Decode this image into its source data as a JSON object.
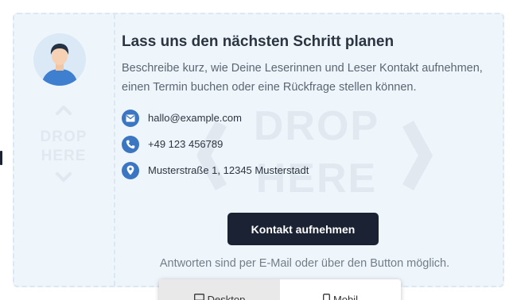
{
  "card": {
    "headline": "Lass uns den nächsten Schritt planen",
    "lead": "Beschreibe kurz, wie Deine Leserinnen und Leser Kontakt aufnehmen, einen Termin buchen oder eine Rückfrage stellen können.",
    "contacts": [
      {
        "icon": "mail-icon",
        "text": "hallo@example.com"
      },
      {
        "icon": "phone-icon",
        "text": "+49 123 456789"
      },
      {
        "icon": "location-pin-icon",
        "text": "Musterstraße 1, 12345 Musterstadt"
      }
    ],
    "cta_label": "Kontakt aufnehmen",
    "footnote": "Antworten sind per E-Mail oder über den Button möglich."
  },
  "dropzones": {
    "small_line1": "DROP",
    "small_line2": "HERE",
    "big_line1": "DROP",
    "big_line2": "HERE"
  },
  "device_toggle": {
    "desktop_label": "Desktop",
    "mobile_label": "Mobil",
    "active": "Mobil"
  },
  "colors": {
    "card_bg": "#eef5fb",
    "accent_icon": "#3b76c2",
    "cta_bg": "#1a2233",
    "headline": "#2b3440"
  }
}
